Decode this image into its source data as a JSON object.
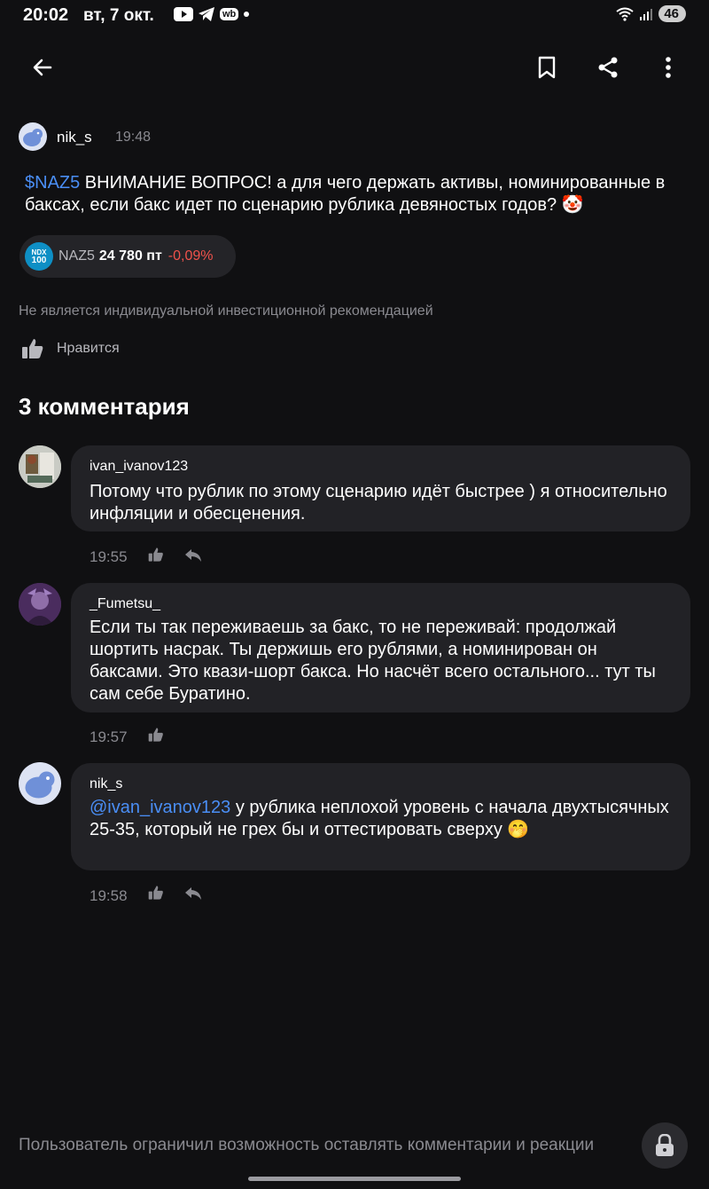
{
  "status_bar": {
    "time": "20:02",
    "date": "вт, 7 окт.",
    "battery": "46",
    "app_icon_wb": "wb"
  },
  "top_bar": {
    "back_icon": "arrow-left-icon",
    "bookmark_icon": "bookmark-icon",
    "share_icon": "share-icon",
    "more_icon": "more-vertical-icon"
  },
  "post": {
    "author": "nik_s",
    "time": "19:48",
    "ticker": "$NAZ5",
    "text": " ВНИМАНИЕ ВОПРОС! а для чего держать активы, номинированные в баксах, если бакс идет по сценарию рублика девяностых годов? 🤡",
    "chip": {
      "logo_line1": "NDX",
      "logo_line2": "100",
      "ticker": "NAZ5",
      "price": "24 780 пт",
      "change": "-0,09%",
      "change_color": "#f0524b"
    },
    "disclaimer": "Не является индивидуальной инвестиционной рекомендацией",
    "like_label": "Нравится"
  },
  "comments_heading": "3 комментария",
  "comments": [
    {
      "author": "ivan_ivanov123",
      "text": "Потому что рублик по этому сценарию идёт быстрее ) я относительно инфляции и обесценения.",
      "time": "19:55"
    },
    {
      "author": "_Fumetsu_",
      "text": "Если ты так переживаешь за бакс, то не переживай: продолжай шортить насрак. Ты держишь его рублями, а номинирован он баксами. Это квази-шорт бакса. Но насчёт всего остального... тут ты сам себе Буратино.",
      "time": "19:57"
    },
    {
      "author": "nik_s",
      "mention": "@ivan_ivanov123",
      "text": " у рублика неплохой уровень с начала двухтысячных 25-35, который не грех бы и оттестировать сверху 🤭",
      "time": "19:58"
    }
  ],
  "footer": {
    "text": "Пользователь ограничил возможность оставлять комментарии и реакции",
    "lock_icon": "lock-icon"
  },
  "colors": {
    "background": "#101012",
    "bubble": "#222226",
    "link": "#4a8ef5",
    "negative": "#f0524b"
  }
}
